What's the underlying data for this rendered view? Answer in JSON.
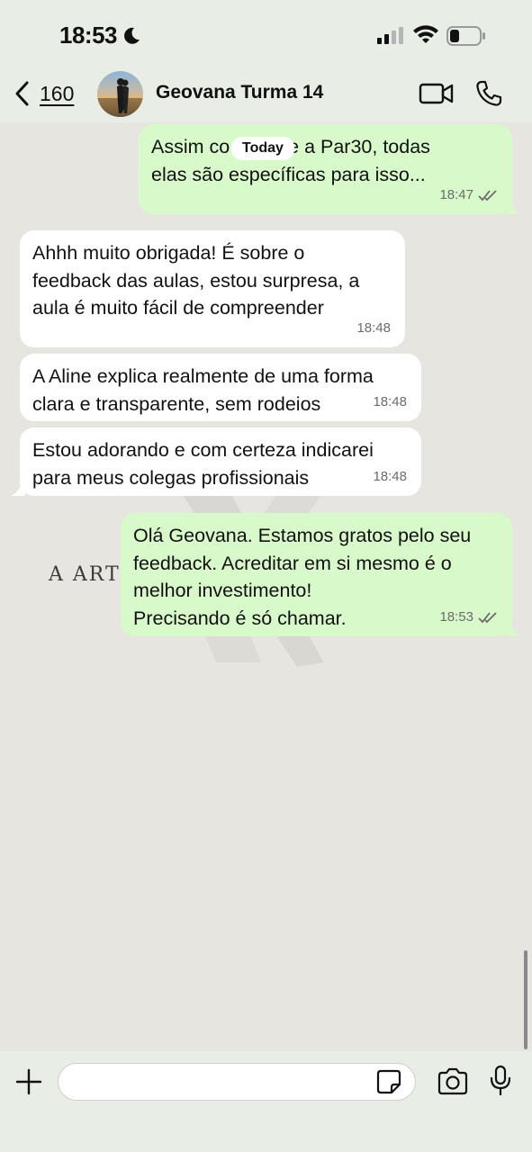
{
  "status_bar": {
    "time": "18:53",
    "icons": [
      "moon-icon",
      "cellular-signal-icon",
      "wifi-icon",
      "battery-icon"
    ]
  },
  "header": {
    "back_count": "160",
    "contact_name": "Geovana Turma 14",
    "icons": [
      "chevron-left-icon",
      "video-call-icon",
      "phone-icon"
    ]
  },
  "chat": {
    "date_label": "Today",
    "watermark_text": "A ART",
    "messages": [
      {
        "direction": "outgoing",
        "text": "Assim co          Ar111 e a Par30, todas\nelas são específicas para isso...",
        "time": "18:47",
        "read": true
      },
      {
        "direction": "incoming",
        "text": "Ahhh muito obrigada! É sobre o\nfeedback das aulas, estou surpresa, a\naula é muito fácil de compreender",
        "time": "18:48"
      },
      {
        "direction": "incoming",
        "text": "A Aline explica realmente de uma forma\nclara e transparente, sem rodeios",
        "time": "18:48"
      },
      {
        "direction": "incoming",
        "text": "Estou adorando e com certeza indicarei\npara meus colegas profissionais",
        "time": "18:48"
      },
      {
        "direction": "outgoing",
        "text": "Olá Geovana. Estamos gratos pelo seu\nfeedback. Acreditar em si mesmo é o\nmelhor investimento!\nPrecisando é só chamar.",
        "time": "18:53",
        "read": true
      }
    ]
  },
  "input_bar": {
    "message_value": "",
    "icons": [
      "plus-icon",
      "sticker-icon",
      "camera-icon",
      "microphone-icon"
    ]
  },
  "colors": {
    "outgoing_bubble": "#d8f9c9",
    "incoming_bubble": "#ffffff",
    "chat_background": "#e6e5e0",
    "bars_background": "#e8ede6"
  }
}
